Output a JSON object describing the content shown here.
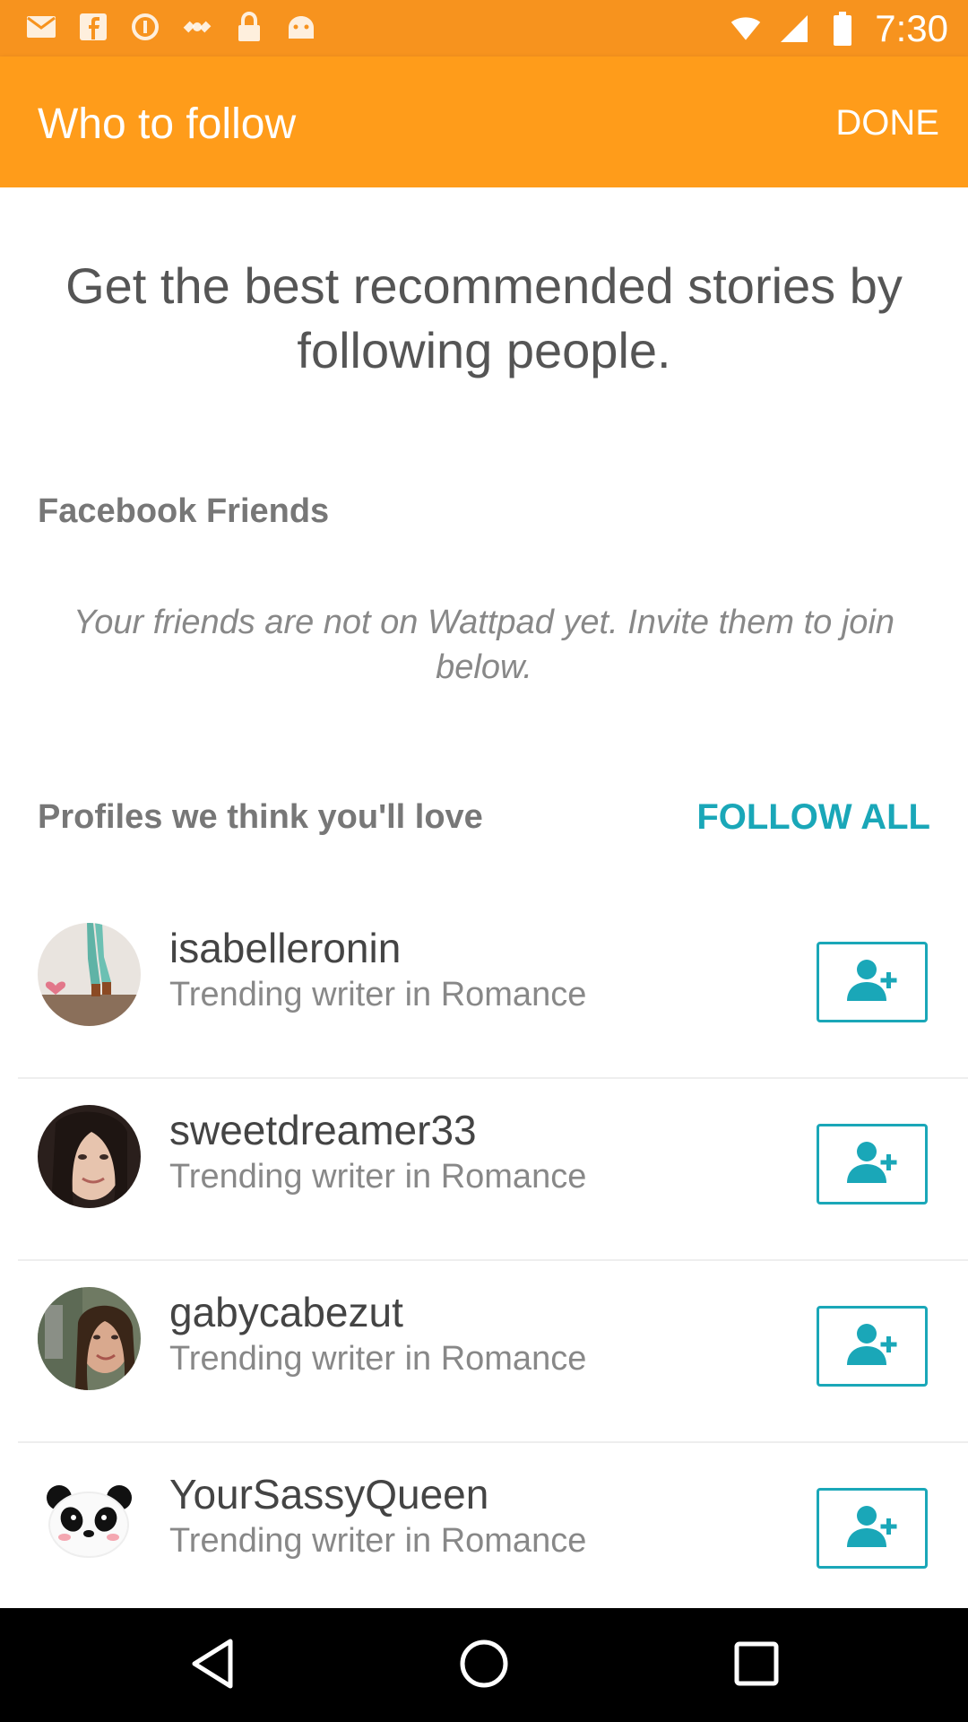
{
  "status_bar": {
    "time": "7:30",
    "icons": [
      "mail-icon",
      "facebook-icon",
      "data-saver-icon",
      "satellite-icon",
      "lock-icon",
      "android-icon",
      "wifi-icon",
      "signal-icon",
      "battery-icon"
    ]
  },
  "app_bar": {
    "title": "Who to follow",
    "done_label": "DONE"
  },
  "main": {
    "headline": "Get the best recommended stories by following people.",
    "facebook_section_title": "Facebook Friends",
    "facebook_note": "Your friends are not on Wattpad yet. Invite them to join below.",
    "profiles_section_title": "Profiles we think you'll love",
    "follow_all_label": "FOLLOW ALL"
  },
  "profiles": [
    {
      "username": "isabelleronin",
      "subtitle": "Trending writer in Romance"
    },
    {
      "username": "sweetdreamer33",
      "subtitle": "Trending writer in Romance"
    },
    {
      "username": "gabycabezut",
      "subtitle": "Trending writer in Romance"
    },
    {
      "username": "YourSassyQueen",
      "subtitle": "Trending writer in Romance"
    }
  ],
  "colors": {
    "status_bar": "#f7931e",
    "app_bar": "#ff9c1a",
    "accent": "#1aa7b8"
  },
  "nav_bar": {
    "icons": [
      "back-icon",
      "home-icon",
      "recents-icon"
    ]
  }
}
